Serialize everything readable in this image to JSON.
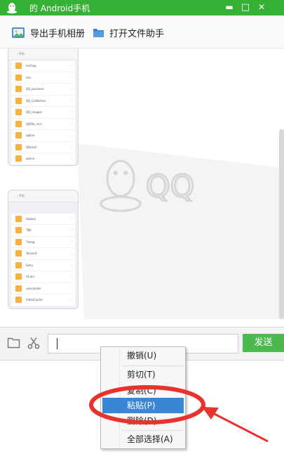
{
  "window": {
    "title": "的 Android手机",
    "controls": {
      "minimize": "▬",
      "maximize": "□",
      "close": "✕"
    }
  },
  "toolbar": {
    "export_label": "导出手机相册",
    "file_helper_label": "打开文件助手"
  },
  "chat": {
    "watermark_text": "QQ",
    "thumb1": {
      "header": "‹ 手机",
      "files": [
        "mishop",
        "mix",
        "QQ_business",
        "QQ_Collection",
        "QQ_Images",
        "QQfile_recv",
        "qqlive",
        "QQmail",
        "qzone"
      ]
    },
    "thumb2": {
      "header": "‹ 手机",
      "files": [
        "",
        "taobao",
        "TBS",
        "Tmlog",
        "Tencent",
        "Sohu",
        "UCam",
        "usercenter",
        "VideoCache"
      ]
    }
  },
  "input": {
    "value": "",
    "send_label": "发送"
  },
  "context_menu": {
    "items": [
      {
        "label": "撤销(U)",
        "enabled": true
      },
      {
        "label": "剪切(T)",
        "enabled": true
      },
      {
        "label": "复制(C)",
        "enabled": true
      },
      {
        "label": "粘贴(P)",
        "enabled": true,
        "selected": true
      },
      {
        "label": "删除(D)",
        "enabled": true
      },
      {
        "label": "全部选择(A)",
        "enabled": true
      }
    ]
  },
  "colors": {
    "title_green": "#35b235",
    "send_green": "#4db84f",
    "menu_highlight": "#3a86d6",
    "annotation_red": "#e8322c"
  }
}
